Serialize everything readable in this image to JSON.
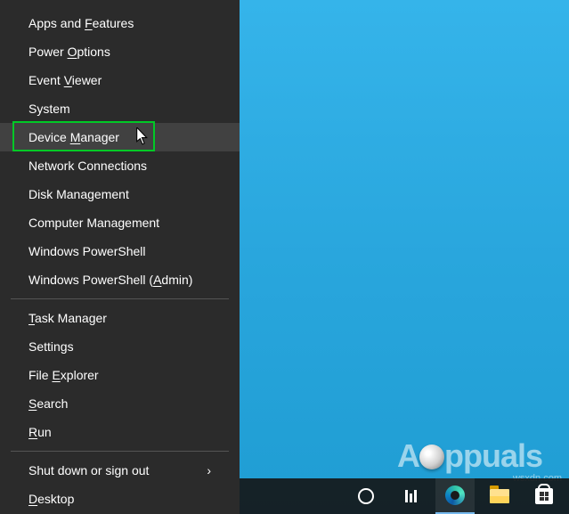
{
  "menu": {
    "groups": [
      [
        {
          "label": "Apps and Features",
          "underline": "F",
          "id": "apps-and-features"
        },
        {
          "label": "Power Options",
          "underline": "O",
          "id": "power-options"
        },
        {
          "label": "Event Viewer",
          "underline": "V",
          "id": "event-viewer"
        },
        {
          "label": "System",
          "underline": "Y",
          "id": "system"
        },
        {
          "label": "Device Manager",
          "underline": "M",
          "id": "device-manager",
          "hovered": true,
          "highlighted": true
        },
        {
          "label": "Network Connections",
          "underline": "W",
          "id": "network-connections"
        },
        {
          "label": "Disk Management",
          "underline": "K",
          "id": "disk-management"
        },
        {
          "label": "Computer Management",
          "underline": "G",
          "id": "computer-management"
        },
        {
          "label": "Windows PowerShell",
          "underline": "I",
          "id": "windows-powershell"
        },
        {
          "label": "Windows PowerShell (Admin)",
          "underline": "A",
          "id": "windows-powershell-admin"
        }
      ],
      [
        {
          "label": "Task Manager",
          "underline": "T",
          "id": "task-manager"
        },
        {
          "label": "Settings",
          "underline": "N",
          "id": "settings"
        },
        {
          "label": "File Explorer",
          "underline": "E",
          "id": "file-explorer"
        },
        {
          "label": "Search",
          "underline": "S",
          "id": "search"
        },
        {
          "label": "Run",
          "underline": "R",
          "id": "run"
        }
      ],
      [
        {
          "label": "Shut down or sign out",
          "underline": "U",
          "id": "shut-down-or-sign-out",
          "submenu": true
        },
        {
          "label": "Desktop",
          "underline": "D",
          "id": "desktop"
        }
      ]
    ]
  },
  "taskbar": {
    "items": [
      {
        "id": "cortana",
        "name": "cortana-icon"
      },
      {
        "id": "taskview",
        "name": "task-view-icon"
      },
      {
        "id": "edge",
        "name": "edge-icon",
        "active": true
      },
      {
        "id": "explorer",
        "name": "file-explorer-icon"
      },
      {
        "id": "store",
        "name": "microsoft-store-icon"
      }
    ]
  },
  "watermark": {
    "brand": "ppuals",
    "sub": "wsxdn.com"
  }
}
